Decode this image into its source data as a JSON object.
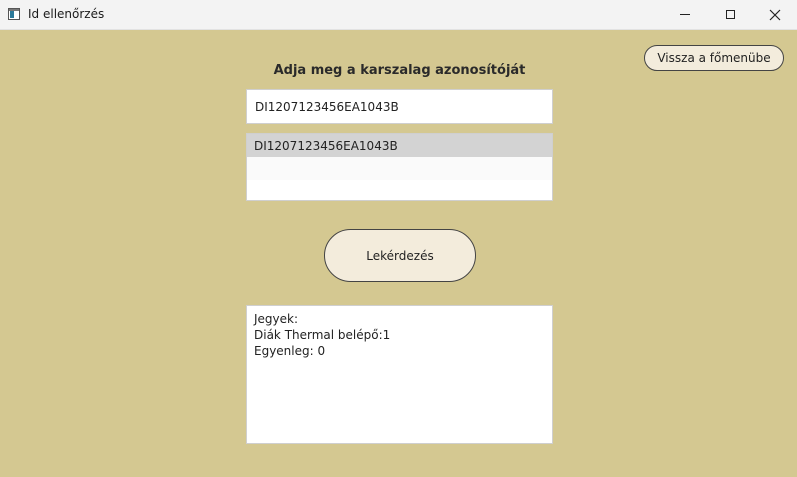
{
  "window": {
    "title": "Id ellenőrzés"
  },
  "colors": {
    "background": "#d4c891",
    "button_fill": "#f3ecdc",
    "selected_item": "#d3d3d3"
  },
  "back_button": {
    "label": "Vissza a főmenübe"
  },
  "prompt": {
    "label": "Adja meg a karszalag azonosítóját"
  },
  "id_input": {
    "value": "DI1207123456EA1043B"
  },
  "suggestions": {
    "items": [
      "DI1207123456EA1043B"
    ]
  },
  "query_button": {
    "label": "Lekérdezés"
  },
  "result": {
    "lines": [
      "Jegyek:",
      "Diák Thermal belépő:1",
      "Egyenleg: 0"
    ]
  }
}
